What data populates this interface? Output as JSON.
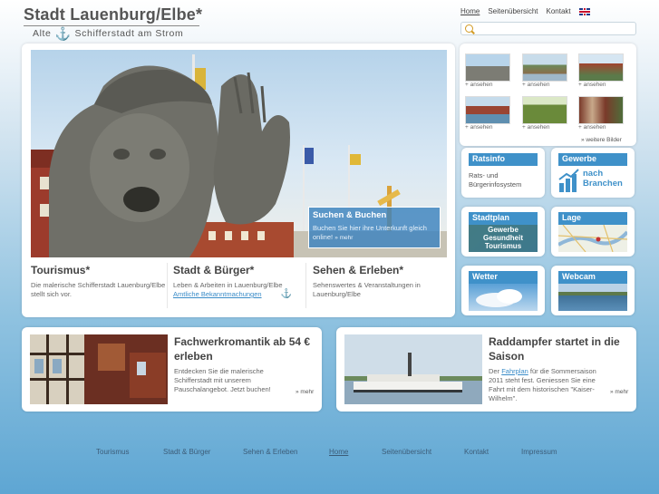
{
  "header": {
    "logo_title": "Stadt Lauenburg/Elbe*",
    "logo_sub_left": "Alte",
    "logo_sub_right": "Schifferstadt am Strom",
    "nav": [
      {
        "label": "Home",
        "active": true
      },
      {
        "label": "Seitenübersicht"
      },
      {
        "label": "Kontakt"
      }
    ],
    "search_placeholder": ""
  },
  "hero": {
    "overlay_title": "Suchen & Buchen",
    "overlay_text": "Buchen Sie hier ihre Unterkunft gleich online!",
    "overlay_more": "mehr"
  },
  "columns": [
    {
      "title": "Tourismus*",
      "text": "Die malerische Schifferstadt Lauenburg/Elbe stellt sich vor."
    },
    {
      "title": "Stadt & Bürger*",
      "text": "Leben & Arbeiten in Lauenburg/Elbe",
      "link": "Amtliche Bekanntmachungen"
    },
    {
      "title": "Sehen & Erleben*",
      "text": "Sehenswertes & Veranstaltungen in Lauenburg/Elbe"
    }
  ],
  "thumbnails": {
    "label": "+ ansehen",
    "more": "» weitere Bilder"
  },
  "tiles": [
    {
      "title": "Ratsinfo",
      "body_line1": "Rats- und",
      "body_line2": "Bürgerinfosystem"
    },
    {
      "title": "Gewerbe",
      "body_line1": "nach",
      "body_line2": "Branchen"
    },
    {
      "title": "Stadtplan",
      "body_line1": "Gewerbe",
      "body_line2": "Gesundheit",
      "body_line3": "Tourismus"
    },
    {
      "title": "Lage"
    },
    {
      "title": "Wetter"
    },
    {
      "title": "Webcam"
    }
  ],
  "teasers": [
    {
      "title": "Fachwerkromantik ab 54 € erleben",
      "text": "Entdecken Sie die malerische Schifferstadt mit unserem Pauschalangebot. Jetzt buchen!",
      "more": "» mehr"
    },
    {
      "title": "Raddampfer startet in die Saison",
      "text_pre": "Der",
      "link": "Fahrplan",
      "text_post": "für die Sommersaison 2011 steht fest. Geniessen Sie eine Fahrt mit dem historischen \"Kaiser-Wilhelm\".",
      "more": "» mehr"
    }
  ],
  "footer": [
    {
      "label": "Tourismus"
    },
    {
      "label": "Stadt & Bürger"
    },
    {
      "label": "Sehen & Erleben"
    },
    {
      "label": "Home",
      "active": true
    },
    {
      "label": "Seitenübersicht"
    },
    {
      "label": "Kontakt"
    },
    {
      "label": "Impressum"
    }
  ],
  "colors": {
    "accent_blue": "#3f91c9",
    "link_blue": "#3a8cc8",
    "search_icon": "#d29a22"
  }
}
